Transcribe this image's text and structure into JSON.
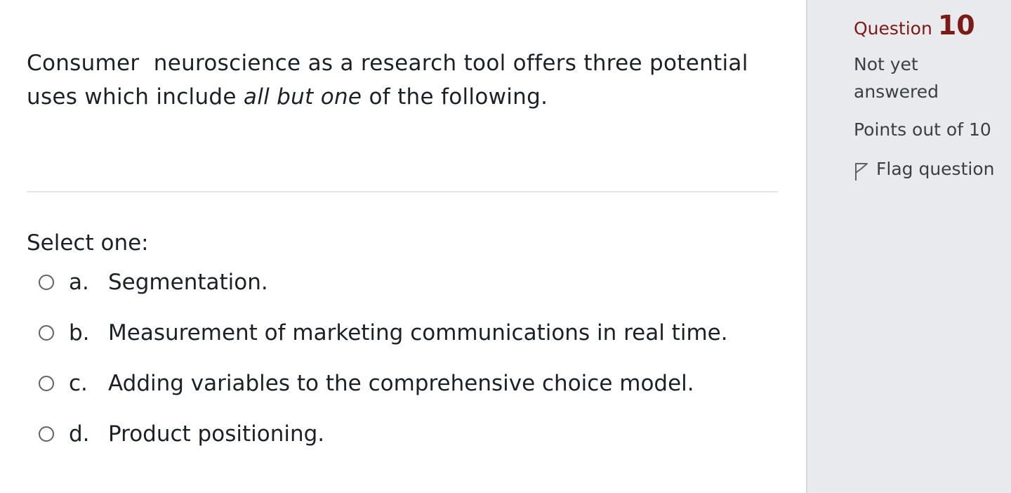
{
  "question": {
    "text_part1": "Consumer  neuroscience as a research tool offers three potential uses which include ",
    "text_emphasis": "all but one",
    "text_part2": " of the following.",
    "prompt": "Select one:",
    "answers": [
      {
        "letter": "a.",
        "label": "Segmentation.",
        "selected": false
      },
      {
        "letter": "b.",
        "label": "Measurement of marketing communications in real time.",
        "selected": false
      },
      {
        "letter": "c.",
        "label": "Adding variables to the comprehensive choice model.",
        "selected": false
      },
      {
        "letter": "d.",
        "label": "Product positioning.",
        "selected": false
      }
    ]
  },
  "info": {
    "question_label": "Question",
    "question_number": "10",
    "state": "Not yet answered",
    "grade": "Points out of 10",
    "flag_label": "Flag question",
    "flag_icon": "flag-outline-icon"
  },
  "colors": {
    "accent": "#7a1b17",
    "sidebar_bg": "#e9eaed",
    "divider": "#e6e6e6",
    "text": "#1d2125"
  }
}
